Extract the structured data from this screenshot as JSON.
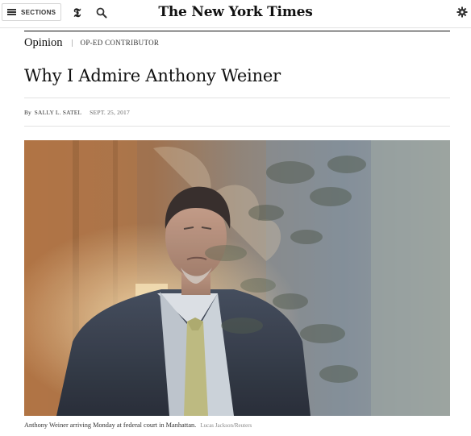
{
  "header": {
    "sections_label": "SECTIONS",
    "t_logo": "𝕿",
    "masthead": "The New York Times",
    "icons": {
      "menu": "hamburger-icon",
      "search": "search-icon",
      "settings": "gear-icon"
    }
  },
  "article": {
    "kicker": "Opinion",
    "section": "OP-ED CONTRIBUTOR",
    "headline": "Why I Admire Anthony Weiner",
    "byline_prefix": "By",
    "author": "SALLY L. SATEL",
    "date": "SEPT. 25, 2017"
  },
  "photo": {
    "caption": "Anthony Weiner arriving Monday at federal court in Manhattan.",
    "credit": "Lucas Jackson/Reuters"
  }
}
